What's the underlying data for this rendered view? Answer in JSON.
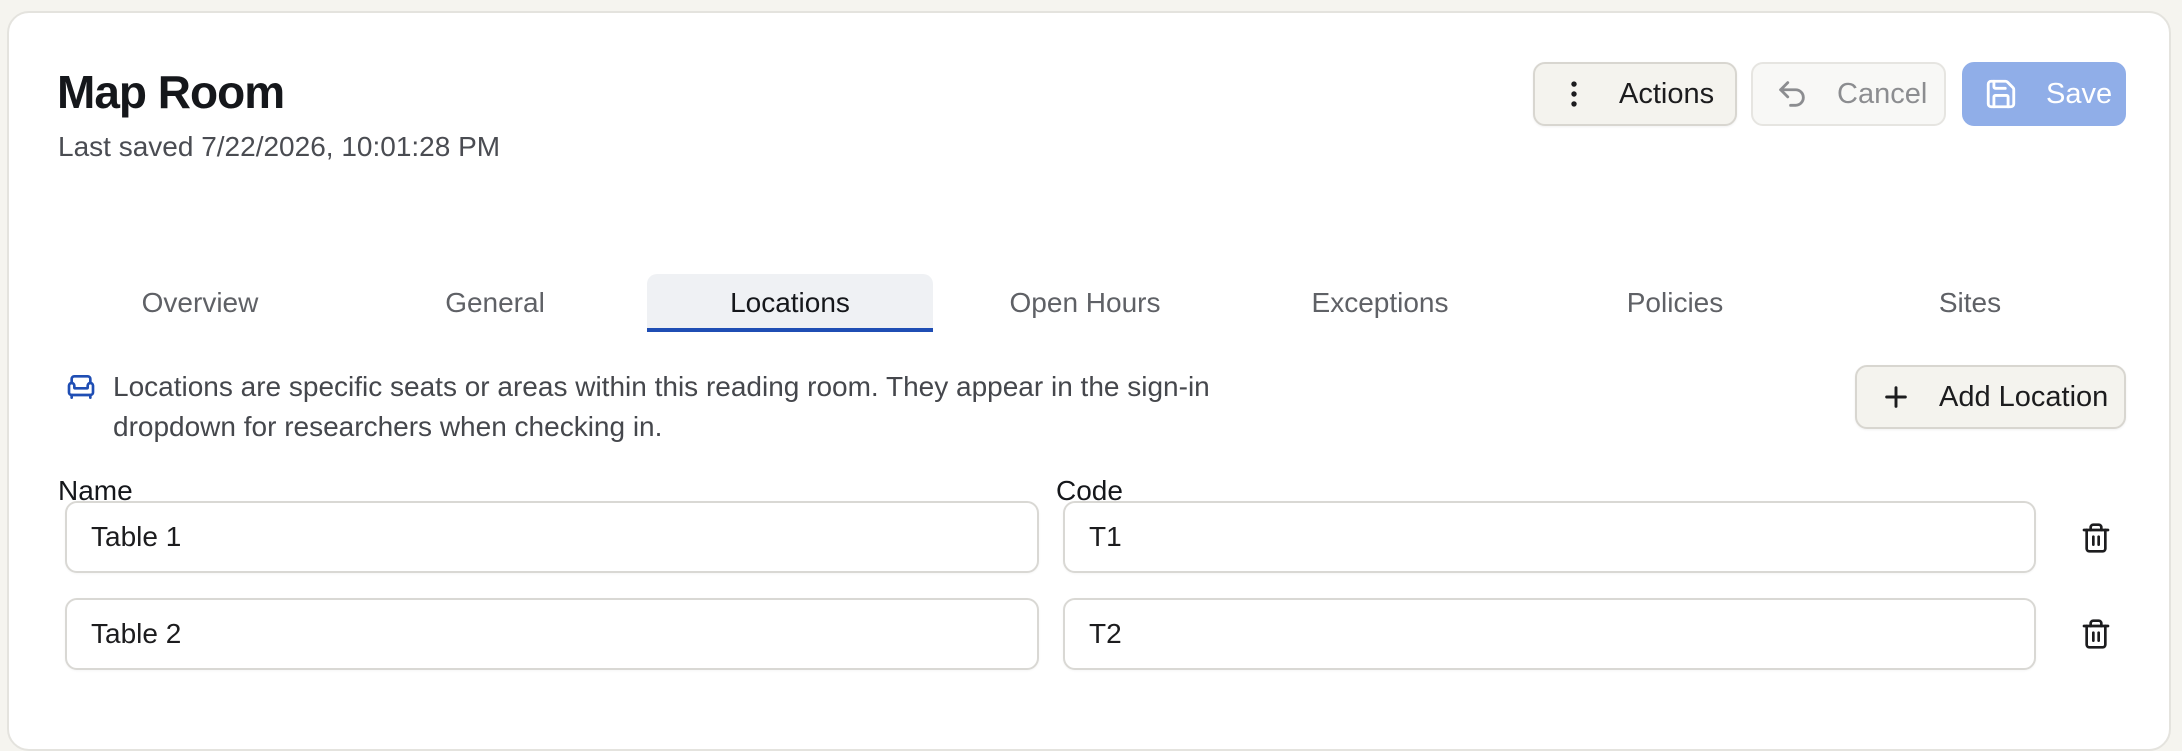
{
  "header": {
    "title": "Map Room",
    "subtitle": "Last saved 7/22/2026, 10:01:28 PM"
  },
  "toolbar": {
    "actions_label": "Actions",
    "cancel_label": "Cancel",
    "save_label": "Save",
    "actions_icon": "more-vertical-icon",
    "cancel_icon": "undo-icon",
    "save_icon": "floppy-disk-icon",
    "save_bg_color": "#90aee8"
  },
  "tabs": [
    {
      "label": "Overview"
    },
    {
      "label": "General"
    },
    {
      "label": "Locations",
      "active": true
    },
    {
      "label": "Open Hours"
    },
    {
      "label": "Exceptions"
    },
    {
      "label": "Policies"
    },
    {
      "label": "Sites"
    }
  ],
  "locations": {
    "info_icon": "armchair-icon",
    "info_text": "Locations are specific seats or areas within this reading room. They appear in the sign-in dropdown for researchers when checking in.",
    "add_label": "Add Location",
    "add_icon": "plus-icon",
    "columns": {
      "name": "Name",
      "code": "Code"
    },
    "rows": [
      {
        "name": "Table 1",
        "code": "T1"
      },
      {
        "name": "Table 2",
        "code": "T2"
      }
    ],
    "row_action_icon": "trash-icon"
  },
  "colors": {
    "accent": "#1f4eb4",
    "page_bg": "#f5f4ef"
  }
}
